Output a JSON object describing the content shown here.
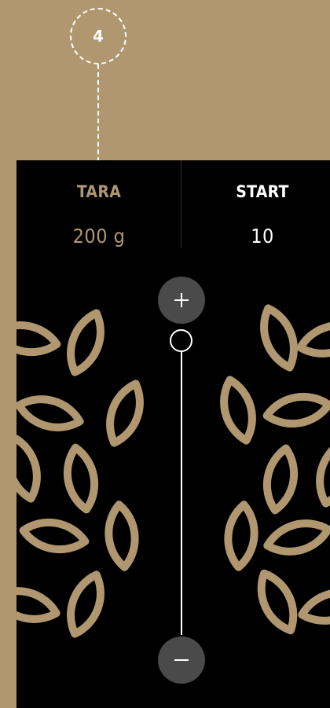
{
  "annotation": {
    "number": "4"
  },
  "tara": {
    "label": "TARA",
    "value": "200 g"
  },
  "start": {
    "label": "START",
    "value": "10"
  },
  "slider": {
    "increase_icon": "plus-icon",
    "decrease_icon": "minus-icon"
  },
  "colors": {
    "background": "#b09770",
    "panel": "#000000",
    "accent": "#b09770",
    "button": "#4a4a4a",
    "text": "#ffffff"
  }
}
